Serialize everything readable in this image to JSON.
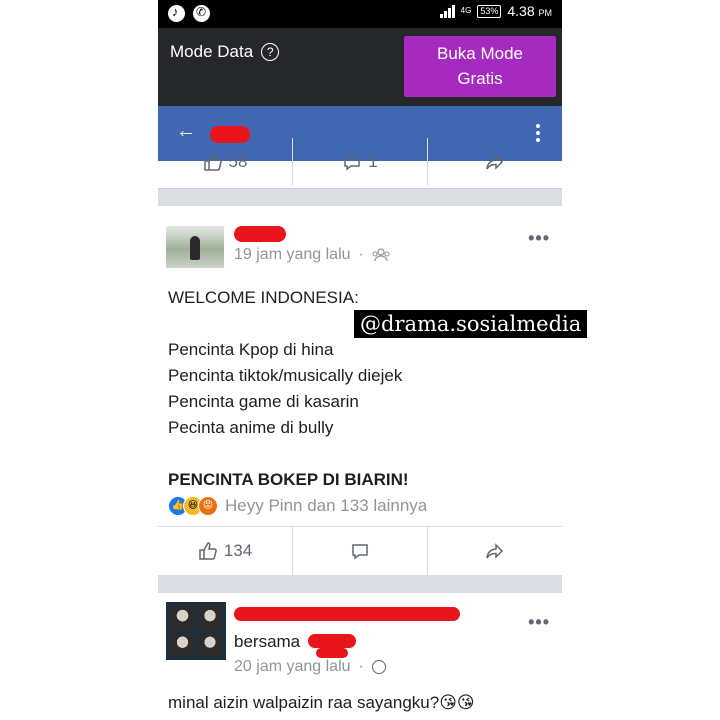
{
  "status_bar": {
    "network": "4G",
    "battery": "53%",
    "time": "4.38",
    "ampm": "PM"
  },
  "data_mode": {
    "label": "Mode Data",
    "free_button_line1": "Buka Mode",
    "free_button_line2": "Gratis"
  },
  "top_actions": {
    "like_count": "58",
    "comment_count": "1"
  },
  "post1": {
    "time": "19 jam yang lalu",
    "separator": "·",
    "lines": [
      "WELCOME INDONESIA:",
      "Pencinta Kpop di hina",
      "Pencinta tiktok/musically diejek",
      "Pencinta game di kasarin",
      "Pecinta anime di bully",
      "PENCINTA BOKEP DI BIARIN!"
    ],
    "reactions_text": "Heyy Pinn dan 133 lainnya",
    "like_count": "134"
  },
  "watermark": "@drama.sosialmedia",
  "post2": {
    "shared_prefix": "bersama",
    "time": "20 jam yang lalu",
    "separator": "·",
    "text": "minal aizin walpaizin raa sayangku?😘😘"
  },
  "more_dots": "•••",
  "colors": {
    "fb_blue": "#4267b2",
    "free_button": "#a42bbd",
    "redaction": "#e8151c"
  }
}
